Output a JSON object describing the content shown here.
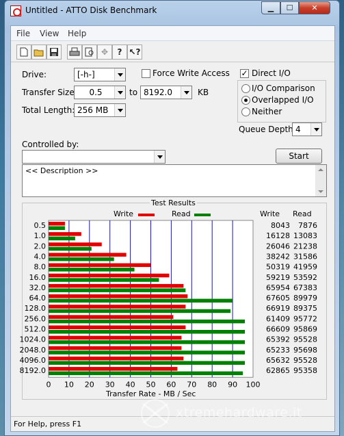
{
  "window": {
    "title": "Untitled - ATTO Disk Benchmark",
    "minimize": "▁",
    "maximize": "☐",
    "close": "✕"
  },
  "menu": [
    "File",
    "View",
    "Help"
  ],
  "toolbar": [
    "new-icon",
    "open-icon",
    "save-icon",
    "print-icon",
    "print-preview-icon",
    "move-icon",
    "help-icon",
    "context-help-icon"
  ],
  "form": {
    "drive_label": "Drive:",
    "drive_value": "[-h-]",
    "force_write_label": "Force Write Access",
    "force_write_checked": false,
    "direct_io_label": "Direct I/O",
    "direct_io_checked": true,
    "transfer_label": "Transfer Size:",
    "transfer_from": "0.5",
    "to_label": "to",
    "transfer_to": "8192.0",
    "kb_label": "KB",
    "length_label": "Total Length:",
    "length_value": "256 MB",
    "io_comparison": "I/O Comparison",
    "overlapped_io": "Overlapped I/O",
    "neither": "Neither",
    "queue_label": "Queue Depth:",
    "queue_value": "4",
    "controlled_label": "Controlled by:",
    "controlled_value": "",
    "start_label": "Start",
    "description": "<< Description >>"
  },
  "results": {
    "title": "Test Results",
    "write_label": "Write",
    "read_label": "Read",
    "col_write": "Write",
    "col_read": "Read",
    "axis_label": "Transfer Rate - MB / Sec"
  },
  "chart_data": {
    "type": "bar",
    "title": "Test Results",
    "xlabel": "Transfer Rate - MB / Sec",
    "xlim": [
      0,
      100
    ],
    "x_ticks": [
      "0",
      "10",
      "20",
      "30",
      "40",
      "50",
      "60",
      "70",
      "80",
      "90",
      "100"
    ],
    "grid": true,
    "legend": "top",
    "categories": [
      "0.5",
      "1.0",
      "2.0",
      "4.0",
      "8.0",
      "16.0",
      "32.0",
      "64.0",
      "128.0",
      "256.0",
      "512.0",
      "1024.0",
      "2048.0",
      "4096.0",
      "8192.0"
    ],
    "series": [
      {
        "name": "Write",
        "color": "#e00000",
        "values": [
          8,
          16,
          26,
          38,
          50,
          59,
          66,
          68,
          67,
          61,
          67,
          65,
          65,
          66,
          63
        ],
        "labels": [
          "8043",
          "16128",
          "26046",
          "38242",
          "50319",
          "59219",
          "65954",
          "67605",
          "66919",
          "61409",
          "66609",
          "65392",
          "65233",
          "65632",
          "62865"
        ]
      },
      {
        "name": "Read",
        "color": "#008000",
        "values": [
          8,
          13,
          21,
          32,
          42,
          54,
          67,
          90,
          89,
          96,
          96,
          96,
          96,
          96,
          95
        ],
        "labels": [
          "7876",
          "13083",
          "21238",
          "31586",
          "41959",
          "53592",
          "67383",
          "89979",
          "89375",
          "95772",
          "95869",
          "95528",
          "95698",
          "95528",
          "95358"
        ]
      }
    ]
  },
  "status": {
    "text": "For Help, press F1"
  },
  "watermark": {
    "text": "xtremehardware.it"
  }
}
